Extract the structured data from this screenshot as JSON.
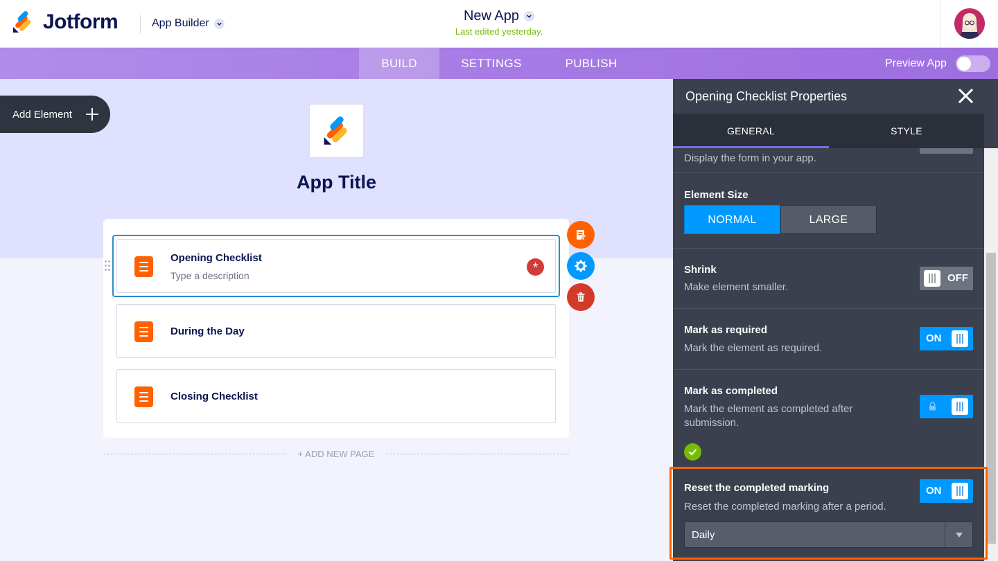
{
  "header": {
    "brand": "Jotform",
    "product": "App Builder",
    "app_name": "New App",
    "last_edited": "Last edited yesterday."
  },
  "nav": {
    "tabs": [
      {
        "label": "BUILD",
        "active": true
      },
      {
        "label": "SETTINGS",
        "active": false
      },
      {
        "label": "PUBLISH",
        "active": false
      }
    ],
    "preview_label": "Preview App"
  },
  "canvas": {
    "add_element_label": "Add Element",
    "app_title": "App Title",
    "items": [
      {
        "title": "Opening Checklist",
        "description": "Type a description",
        "selected": true,
        "required": true
      },
      {
        "title": "During the Day",
        "description": "",
        "selected": false,
        "required": false
      },
      {
        "title": "Closing Checklist",
        "description": "",
        "selected": false,
        "required": false
      }
    ],
    "required_mark": "*",
    "add_page_label": "+ ADD NEW PAGE"
  },
  "panel": {
    "title": "Opening Checklist Properties",
    "tabs": [
      {
        "label": "GENERAL",
        "active": true
      },
      {
        "label": "STYLE",
        "active": false
      }
    ],
    "display_form_desc": "Display the form in your app.",
    "element_size": {
      "title": "Element Size",
      "options": [
        "NORMAL",
        "LARGE"
      ],
      "selected": "NORMAL"
    },
    "shrink": {
      "title": "Shrink",
      "desc": "Make element smaller.",
      "state": "OFF"
    },
    "mark_required": {
      "title": "Mark as required",
      "desc": "Mark the element as required.",
      "state": "ON"
    },
    "mark_completed": {
      "title": "Mark as completed",
      "desc": "Mark the element as completed after submission.",
      "locked": true
    },
    "reset_completed": {
      "title": "Reset the completed marking",
      "desc": "Reset the completed marking after a period.",
      "state": "ON",
      "period": "Daily"
    }
  },
  "colors": {
    "brand_orange": "#ff6100",
    "accent_blue": "#0099ff",
    "success_green": "#78bb07",
    "panel_bg": "#3a404d",
    "nav_purple": "#a67be4"
  }
}
